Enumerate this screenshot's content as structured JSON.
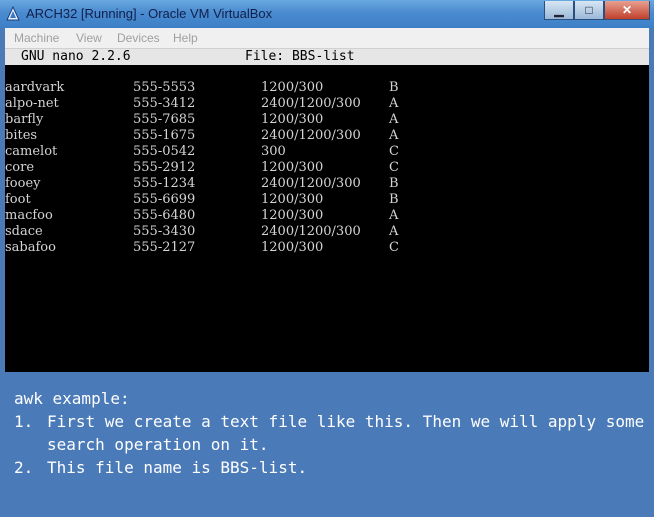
{
  "window": {
    "title": "ARCH32 [Running] - Oracle VM VirtualBox",
    "buttons": {
      "minimize": "▁",
      "maximize": "□",
      "close": "✕"
    }
  },
  "menubar": {
    "items": [
      "Machine",
      "View",
      "Devices",
      "Help"
    ]
  },
  "nano": {
    "version": "GNU nano 2.2.6",
    "file": "File: BBS-list"
  },
  "bbs_list": [
    {
      "name": "aardvark",
      "phone": "555-5553",
      "baud": "1200/300",
      "class": "B"
    },
    {
      "name": "alpo-net",
      "phone": "555-3412",
      "baud": "2400/1200/300",
      "class": "A"
    },
    {
      "name": "barfly",
      "phone": "555-7685",
      "baud": "1200/300",
      "class": "A"
    },
    {
      "name": "bites",
      "phone": "555-1675",
      "baud": "2400/1200/300",
      "class": "A"
    },
    {
      "name": "camelot",
      "phone": "555-0542",
      "baud": "300",
      "class": "C"
    },
    {
      "name": "core",
      "phone": "555-2912",
      "baud": "1200/300",
      "class": "C"
    },
    {
      "name": "fooey",
      "phone": "555-1234",
      "baud": "2400/1200/300",
      "class": "B"
    },
    {
      "name": "foot",
      "phone": "555-6699",
      "baud": "1200/300",
      "class": "B"
    },
    {
      "name": "macfoo",
      "phone": "555-6480",
      "baud": "1200/300",
      "class": "A"
    },
    {
      "name": "sdace",
      "phone": "555-3430",
      "baud": "2400/1200/300",
      "class": "A"
    },
    {
      "name": "sabafoo",
      "phone": "555-2127",
      "baud": "1200/300",
      "class": "C"
    }
  ],
  "caption": {
    "title": "awk example:",
    "items": [
      {
        "num": "1.",
        "text": "First we create a text file like this. Then we will apply some search operation on it."
      },
      {
        "num": "2.",
        "text": "This file name is BBS-list."
      }
    ]
  },
  "colors": {
    "titlebar": "#4a8bd0",
    "caption_bg": "#4a7ab8",
    "terminal_bg": "#000000",
    "terminal_fg": "#d4d4d4"
  }
}
